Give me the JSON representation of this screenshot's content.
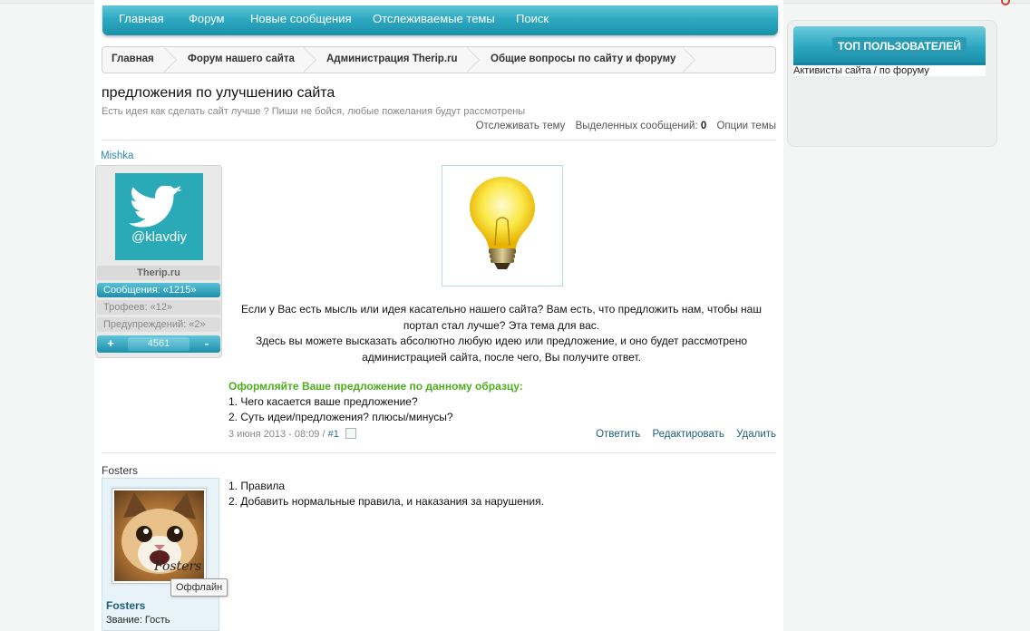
{
  "nav": {
    "items": [
      "Главная",
      "Форум",
      "Новые сообщения",
      "Отслеживаемые темы",
      "Поиск"
    ]
  },
  "breadcrumb": [
    "Главная",
    "Форум нашего сайта",
    "Администрация Therip.ru",
    "Общие вопросы по сайту и форуму"
  ],
  "thread": {
    "title": "предложения по улучшению сайта",
    "subtitle": "Есть идея как сделать сайт лучше ? Пиши не бойся, любые пожелания будут рассмотрены",
    "tools": {
      "track": "Отслеживать тему",
      "selected_label": "Выделенных сообщений:",
      "selected_count": "0",
      "options": "Опции темы"
    }
  },
  "post1": {
    "author": "Mishka",
    "avatar_handle": "@klavdiy",
    "site": "Therip.ru",
    "messages": "Сообщения: «1215»",
    "trophies": "Трофеев: «12»",
    "warnings": "Предупреждений: «2»",
    "reputation_plus": "+",
    "reputation_minus": "-",
    "reputation": "4561",
    "text_lines": [
      "Если у Вас есть мысль или идея касательно нашего сайта? Вам есть, что предложить нам, чтобы наш",
      "портал стал лучше? Эта тема для вас.",
      "Здесь вы можете высказать абсолютно любую идею или предложение, и оно будет рассмотрено",
      "администрацией сайта, после чего, Вы получите ответ."
    ],
    "template_heading": "Оформляйте Ваше предложение по данному образцу:",
    "template_items": [
      "1. Чего касается ваше предложение?",
      "2. Суть идеи/предложения? плюсы/минусы?"
    ],
    "date": "3 июня 2013 - 08:09 /",
    "number": "#1",
    "actions": [
      "Ответить",
      "Редактировать",
      "Удалить"
    ]
  },
  "post2": {
    "author": "Fosters",
    "avatar_caption": "Fosters",
    "status": "Оффлайн",
    "name": "Fosters",
    "rank": "Звание: Гость",
    "text_lines": [
      "1. Правила",
      "2. Добавить нормальные правила, и наказания за нарушения."
    ]
  },
  "sidebar": {
    "title": "ТОП ПОЛЬЗОВАТЕЛЕЙ",
    "tabs": "Активисты сайта / по форуму"
  },
  "colors": {
    "accent": "#2ea9c1",
    "link": "#1e5f7a",
    "green": "#4cae1f"
  }
}
